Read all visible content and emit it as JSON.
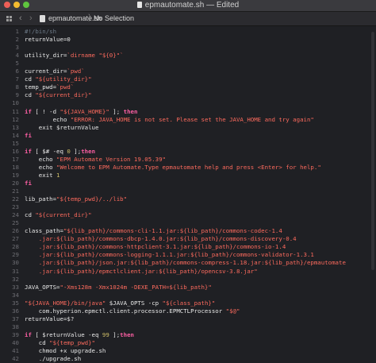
{
  "window": {
    "title": "epmautomate.sh — Edited"
  },
  "jumpbar": {
    "file": "epmautomate.sh",
    "separator": "〉",
    "selection": "No Selection",
    "back": "‹",
    "forward": "›"
  },
  "colors": {
    "keyword": "#fc5fa3",
    "string": "#fc6a5d",
    "number": "#d0bf69",
    "comment": "#6c7986",
    "plain": "#e8e8e8",
    "background": "#1f2024"
  },
  "lines": [
    [
      {
        "t": "#!/bin/sh",
        "c": "cmt"
      }
    ],
    [
      {
        "t": "returnValue=0",
        "c": "var"
      }
    ],
    [],
    [
      {
        "t": "utility_dir=",
        "c": "var"
      },
      {
        "t": "`dirname \"${0}\"`",
        "c": "str"
      }
    ],
    [],
    [
      {
        "t": "current_dir=",
        "c": "var"
      },
      {
        "t": "`pwd`",
        "c": "str"
      }
    ],
    [
      {
        "t": "cd ",
        "c": "var"
      },
      {
        "t": "\"${utility_dir}\"",
        "c": "str"
      }
    ],
    [
      {
        "t": "temp_pwd=",
        "c": "var"
      },
      {
        "t": "`pwd`",
        "c": "str"
      }
    ],
    [
      {
        "t": "cd ",
        "c": "var"
      },
      {
        "t": "\"${current_dir}\"",
        "c": "str"
      }
    ],
    [],
    [
      {
        "t": "if",
        "c": "kw"
      },
      {
        "t": " [ ! -d ",
        "c": "var"
      },
      {
        "t": "\"${JAVA_HOME}\"",
        "c": "str"
      },
      {
        "t": " ]; ",
        "c": "var"
      },
      {
        "t": "then",
        "c": "kw"
      }
    ],
    [
      {
        "t": "        echo ",
        "c": "var"
      },
      {
        "t": "\"ERROR: JAVA_HOME is not set. Please set the JAVA_HOME and try again\"",
        "c": "str"
      }
    ],
    [
      {
        "t": "    exit ",
        "c": "var"
      },
      {
        "t": "$returnValue",
        "c": "var"
      }
    ],
    [
      {
        "t": "fi",
        "c": "kw"
      }
    ],
    [],
    [
      {
        "t": "if",
        "c": "kw"
      },
      {
        "t": " [ $# -eq ",
        "c": "var"
      },
      {
        "t": "0",
        "c": "num"
      },
      {
        "t": " ];",
        "c": "var"
      },
      {
        "t": "then",
        "c": "kw"
      }
    ],
    [
      {
        "t": "    echo ",
        "c": "var"
      },
      {
        "t": "\"EPM Automate Version 19.05.39\"",
        "c": "str"
      }
    ],
    [
      {
        "t": "    echo ",
        "c": "var"
      },
      {
        "t": "\"Welcome to EPM Automate.Type epmautomate help and press <Enter> for help.\"",
        "c": "str"
      }
    ],
    [
      {
        "t": "    exit ",
        "c": "var"
      },
      {
        "t": "1",
        "c": "num"
      }
    ],
    [
      {
        "t": "fi",
        "c": "kw"
      }
    ],
    [],
    [
      {
        "t": "lib_path=",
        "c": "var"
      },
      {
        "t": "\"${temp_pwd}/../lib\"",
        "c": "str"
      }
    ],
    [],
    [
      {
        "t": "cd ",
        "c": "var"
      },
      {
        "t": "\"${current_dir}\"",
        "c": "str"
      }
    ],
    [],
    [
      {
        "t": "class_path=",
        "c": "var"
      },
      {
        "t": "\"${lib_path}/commons-cli-1.1.jar:${lib_path}/commons-codec-1.4",
        "c": "str"
      }
    ],
    [
      {
        "t": "    .jar:${lib_path}/commons-dbcp-1.4.0.jar:${lib_path}/commons-discovery-0.4",
        "c": "str"
      }
    ],
    [
      {
        "t": "    .jar:${lib_path}/commons-httpclient-3.1.jar:${lib_path}/commons-io-1.4",
        "c": "str"
      }
    ],
    [
      {
        "t": "    .jar:${lib_path}/commons-logging-1.1.1.jar:${lib_path}/commons-validator-1.3.1",
        "c": "str"
      }
    ],
    [
      {
        "t": "    .jar:${lib_path}/json.jar:${lib_path}/commons-compress-1.18.jar:${lib_path}/epmautomate",
        "c": "str"
      }
    ],
    [
      {
        "t": "    .jar:${lib_path}/epmctlclient.jar:${lib_path}/opencsv-3.8.jar\"",
        "c": "str"
      }
    ],
    [],
    [
      {
        "t": "JAVA_OPTS=",
        "c": "var"
      },
      {
        "t": "\"-Xms128m -Xmx1024m -DEXE_PATH=${lib_path}\"",
        "c": "str"
      }
    ],
    [],
    [
      {
        "t": "\"${JAVA_HOME}/bin/java\"",
        "c": "str"
      },
      {
        "t": " $JAVA_OPTS -cp ",
        "c": "var"
      },
      {
        "t": "\"${class_path}\"",
        "c": "str"
      }
    ],
    [
      {
        "t": "    com.hyperion.epmctl.client.processor.EPMCTLProcessor ",
        "c": "var"
      },
      {
        "t": "\"$@\"",
        "c": "str"
      }
    ],
    [
      {
        "t": "returnValue=$?",
        "c": "var"
      }
    ],
    [],
    [
      {
        "t": "if",
        "c": "kw"
      },
      {
        "t": " [ $returnValue -eq ",
        "c": "var"
      },
      {
        "t": "99",
        "c": "num"
      },
      {
        "t": " ];",
        "c": "var"
      },
      {
        "t": "then",
        "c": "kw"
      }
    ],
    [
      {
        "t": "    cd ",
        "c": "var"
      },
      {
        "t": "\"${temp_pwd}\"",
        "c": "str"
      }
    ],
    [
      {
        "t": "    chmod +x upgrade.sh",
        "c": "var"
      }
    ],
    [
      {
        "t": "    ./upgrade.sh",
        "c": "var"
      }
    ]
  ]
}
